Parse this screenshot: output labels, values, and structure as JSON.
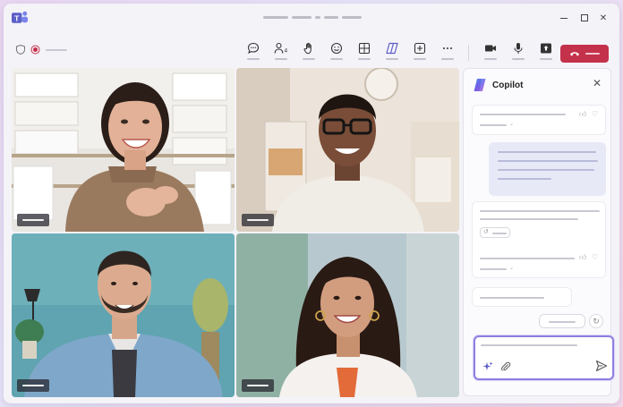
{
  "window": {
    "app_icon": "teams-logo-icon",
    "controls": [
      "minimize-icon",
      "maximize-icon",
      "close-icon"
    ]
  },
  "toolbar": {
    "participants_count": "4",
    "buttons": [
      "chat-icon",
      "people-icon",
      "raise-hand-icon",
      "react-icon",
      "view-icon",
      "copilot-icon",
      "apps-icon",
      "more-icon",
      "camera-icon",
      "mic-icon",
      "share-icon"
    ],
    "leave": "leave-call-icon"
  },
  "colors": {
    "accent": "#6264a7",
    "leave_red": "#c4314b",
    "copilot_border": "#8f7ee0",
    "user_bubble": "#e8e9f7"
  },
  "participants": [
    {
      "tile": "top-left"
    },
    {
      "tile": "top-right"
    },
    {
      "tile": "bottom-left"
    },
    {
      "tile": "bottom-right"
    }
  ],
  "copilot": {
    "title": "Copilot"
  }
}
